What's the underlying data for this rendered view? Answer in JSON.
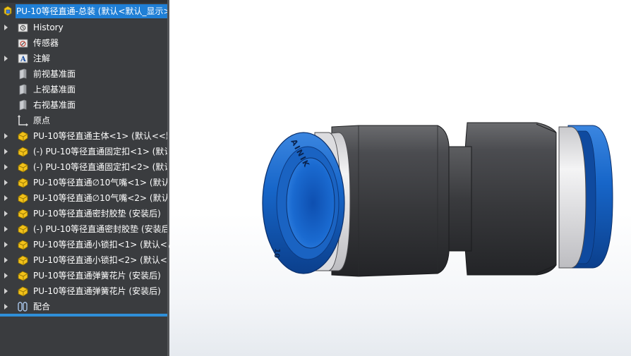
{
  "feature_tree": {
    "root": {
      "label": "PU-10等径直通-总装 (默认<默认_显示>",
      "icon": "assembly-icon"
    },
    "items": [
      {
        "label": "History",
        "icon": "history-folder-icon",
        "expandable": true
      },
      {
        "label": "传感器",
        "icon": "sensor-icon",
        "expandable": false
      },
      {
        "label": "注解",
        "icon": "annotation-icon",
        "expandable": true
      },
      {
        "label": "前视基准面",
        "icon": "plane-icon",
        "expandable": false
      },
      {
        "label": "上视基准面",
        "icon": "plane-icon",
        "expandable": false
      },
      {
        "label": "右视基准面",
        "icon": "plane-icon",
        "expandable": false
      },
      {
        "label": "原点",
        "icon": "origin-icon",
        "expandable": false
      },
      {
        "label": "PU-10等径直通主体<1> (默认<<默",
        "icon": "part-icon",
        "expandable": true
      },
      {
        "label": "(-) PU-10等径直通固定扣<1> (默认",
        "icon": "part-icon",
        "expandable": true
      },
      {
        "label": "(-) PU-10等径直通固定扣<2> (默认",
        "icon": "part-icon",
        "expandable": true
      },
      {
        "label": "PU-10等径直通∅10气嘴<1> (默认",
        "icon": "part-icon",
        "expandable": true
      },
      {
        "label": "PU-10等径直通∅10气嘴<2> (默认",
        "icon": "part-icon",
        "expandable": true
      },
      {
        "label": "PU-10等径直通密封胶垫 (安装后)",
        "icon": "part-icon",
        "expandable": true
      },
      {
        "label": "(-) PU-10等径直通密封胶垫 (安装后",
        "icon": "part-icon",
        "expandable": true
      },
      {
        "label": "PU-10等径直通小锁扣<1> (默认<<",
        "icon": "part-icon",
        "expandable": true
      },
      {
        "label": "PU-10等径直通小锁扣<2> (默认<<",
        "icon": "part-icon",
        "expandable": true
      },
      {
        "label": "PU-10等径直通弹簧花片 (安装后)",
        "icon": "part-icon",
        "expandable": true
      },
      {
        "label": "PU-10等径直通弹簧花片 (安装后)",
        "icon": "part-icon",
        "expandable": true
      },
      {
        "label": "配合",
        "icon": "mates-icon",
        "expandable": true
      }
    ]
  },
  "model": {
    "collet_text": "AINIK",
    "size_text": "10",
    "colors": {
      "body": "#3c3d40",
      "collet": "#1565c8",
      "seal": "#e8e8ea"
    }
  }
}
